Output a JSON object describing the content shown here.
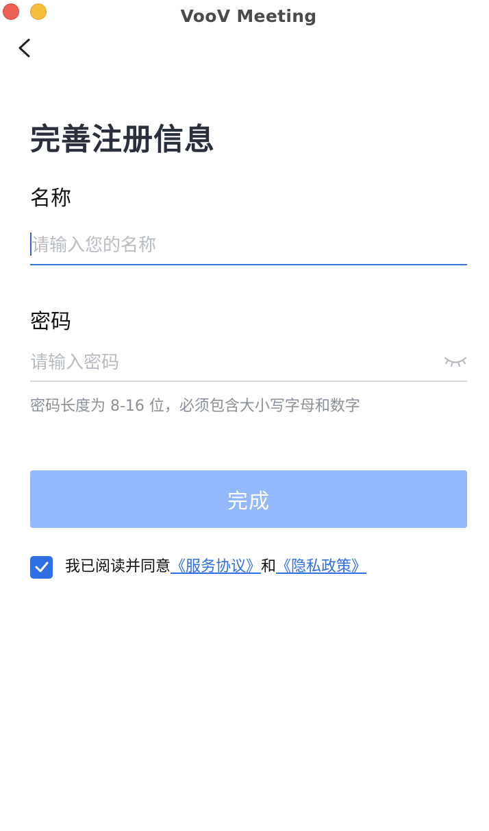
{
  "window": {
    "title": "VooV Meeting"
  },
  "page": {
    "title": "完善注册信息"
  },
  "form": {
    "name": {
      "label": "名称",
      "value": "",
      "placeholder": "请输入您的名称"
    },
    "password": {
      "label": "密码",
      "value": "",
      "placeholder": "请输入密码",
      "toggle_icon": "eye-closed-icon"
    },
    "password_hint": "密码长度为 8-16 位，必须包含大小写字母和数字",
    "submit_label": "完成"
  },
  "agreement": {
    "checked": true,
    "prefix": "我已阅读并同意",
    "terms_link": "《服务协议》",
    "conjunction": "和",
    "privacy_link": "《隐私政策》"
  },
  "colors": {
    "accent": "#2f6fe4",
    "button_disabled": "#93b8fb",
    "focus_underline": "#3a74d8",
    "placeholder": "#b8bcc3",
    "hint_text": "#8a8f99"
  }
}
